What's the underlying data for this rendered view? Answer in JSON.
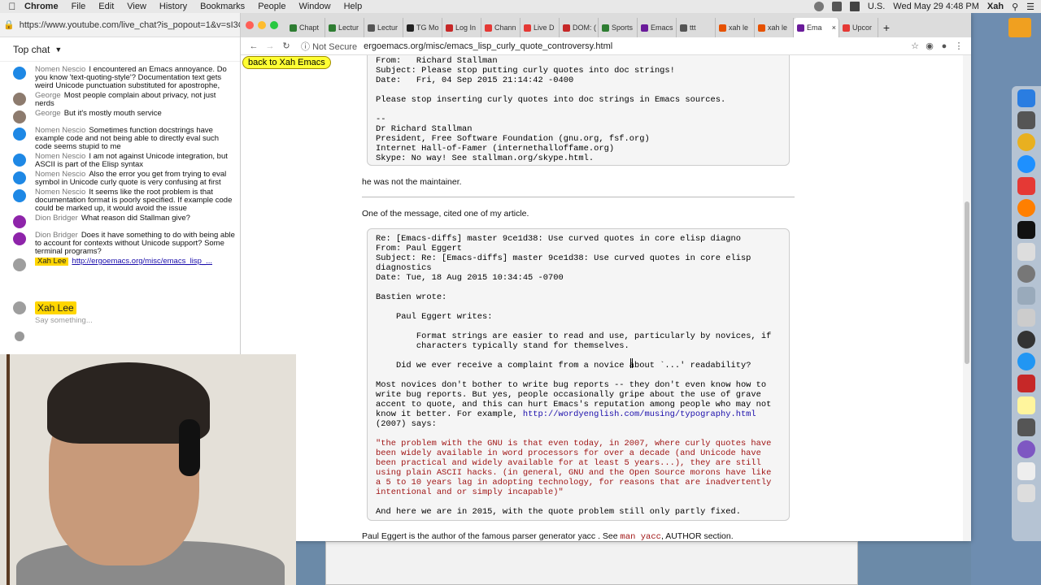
{
  "menubar": {
    "app": "Chrome",
    "items": [
      "File",
      "Edit",
      "View",
      "History",
      "Bookmarks",
      "People",
      "Window",
      "Help"
    ],
    "input_source": "U.S.",
    "clock": "Wed May 29  4:48 PM",
    "user": "Xah"
  },
  "chat": {
    "url": "https://www.youtube.com/live_chat?is_popout=1&v=sI3QfF6-",
    "header": "Top chat",
    "messages": [
      {
        "author": "Nomen Nescio",
        "text": "I encountered an Emacs annoyance. Do you know 'text-quoting-style'? Documentation text gets weird Unicode punctuation substituted for apostrophe, can't eval example code properly",
        "avatar": "blue"
      },
      {
        "author": "George",
        "text": "Most people complain about privacy, not just nerds",
        "avatar": "grey"
      },
      {
        "author": "George",
        "text": "But it's mostly mouth service",
        "avatar": "grey"
      },
      {
        "author": "Nomen Nescio",
        "text": "Sometimes function docstrings have example code and not being able to directly eval such code seems stupid to me",
        "avatar": "blue"
      },
      {
        "author": "Nomen Nescio",
        "text": "I am not against Unicode integration, but ASCII is part of the Elisp syntax",
        "avatar": "blue"
      },
      {
        "author": "Nomen Nescio",
        "text": "Also the error you get from trying to eval symbol in Unicode curly quote is very confusing at first",
        "avatar": "blue"
      },
      {
        "author": "Nomen Nescio",
        "text": "It seems like the root problem is that documentation format is poorly specified. If example code could be marked up, it would avoid the issue",
        "avatar": "blue"
      },
      {
        "author": "Dion Bridger",
        "text": "What reason did Stallman give?",
        "avatar": "purple"
      },
      {
        "author": "Dion Bridger",
        "text": "Does it have something to do with being able to account for contexts without Unicode support? Some terminal programs?",
        "avatar": "purple"
      },
      {
        "author": "Xah Lee",
        "text": "http://ergoemacs.org/misc/emacs_lisp_...",
        "avatar": "xah",
        "owner": true,
        "link": true
      }
    ],
    "input_author": "Xah Lee",
    "input_placeholder": "Say something..."
  },
  "browser": {
    "tabs": [
      {
        "label": "Chapt",
        "color": "#2e7d32"
      },
      {
        "label": "Lectur",
        "color": "#2e7d32"
      },
      {
        "label": "Lectur",
        "color": "#555555"
      },
      {
        "label": "TG Mo",
        "color": "#222222"
      },
      {
        "label": "Log In",
        "color": "#c62828"
      },
      {
        "label": "Chann",
        "color": "#e53935"
      },
      {
        "label": "Live D",
        "color": "#e53935"
      },
      {
        "label": "DOM: (",
        "color": "#c62828"
      },
      {
        "label": "Sports",
        "color": "#2e7d32"
      },
      {
        "label": "Emacs",
        "color": "#6a1b9a"
      },
      {
        "label": "ttt",
        "color": "#555555"
      },
      {
        "label": "xah le",
        "color": "#e65100"
      },
      {
        "label": "xah le",
        "color": "#e65100"
      },
      {
        "label": "Ema",
        "color": "#6a1b9a",
        "active": true
      },
      {
        "label": "Upcor",
        "color": "#e53935"
      }
    ],
    "security": "Not Secure",
    "url": "ergoemacs.org/misc/emacs_lisp_curly_quote_controversy.html"
  },
  "page": {
    "back_button": "back to Xah Emacs",
    "email1": "From:   Richard Stallman\nSubject: Please stop putting curly quotes into doc strings!\nDate:   Fri, 04 Sep 2015 21:14:42 -0400\n\nPlease stop inserting curly quotes into doc strings in Emacs sources.\n\n--\nDr Richard Stallman\nPresident, Free Software Foundation (gnu.org, fsf.org)\nInternet Hall-of-Famer (internethalloffame.org)\nSkype: No way! See stallman.org/skype.html.",
    "para1": "he was not the maintainer.",
    "para2": "One of the message, cited one of my article.",
    "email2_head": "Re: [Emacs-diffs] master 9ce1d38: Use curved quotes in core elisp diagno\nFrom: Paul Eggert\nSubject: Re: [Emacs-diffs] master 9ce1d38: Use curved quotes in core elisp\ndiagnostics\nDate: Tue, 18 Aug 2015 10:34:45 -0700\n\nBastien wrote:\n\n    Paul Eggert writes:\n\n        Format strings are easier to read and use, particularly by novices, if\n        characters typically stand for themselves.\n\n    Did we ever receive a complaint from a novice about `...' readability?\n\nMost novices don't bother to write bug reports -- they don't even know how to\nwrite bug reports. But yes, people occasionally gripe about the use of grave\naccent to quote, and this can hurt Emacs's reputation among people who may not\nknow it better. For example, ",
    "email2_link": "http://wordyenglish.com/musing/typography.html",
    "email2_after_link": "\n(2007) says:\n\n",
    "email2_quote": "\"the problem with the GNU is that even today, in 2007, where curly quotes have\nbeen widely available in word processors for over a decade (and Unicode have\nbeen practical and widely available for at least 5 years...), they are still\nusing plain ASCII hacks. (in general, GNU and the Open Source morons have like\na 5 to 10 years lag in adopting technology, for reasons that are inadvertently\nintentional and or simply incapable)\"",
    "email2_tail": "\n\nAnd here we are in 2015, with the quote problem still only partly fixed.",
    "para3_before": "Paul Eggert is the author of the famous parser generator yacc . See ",
    "para3_code": "man yacc",
    "para3_after": ", AUTHOR section."
  }
}
